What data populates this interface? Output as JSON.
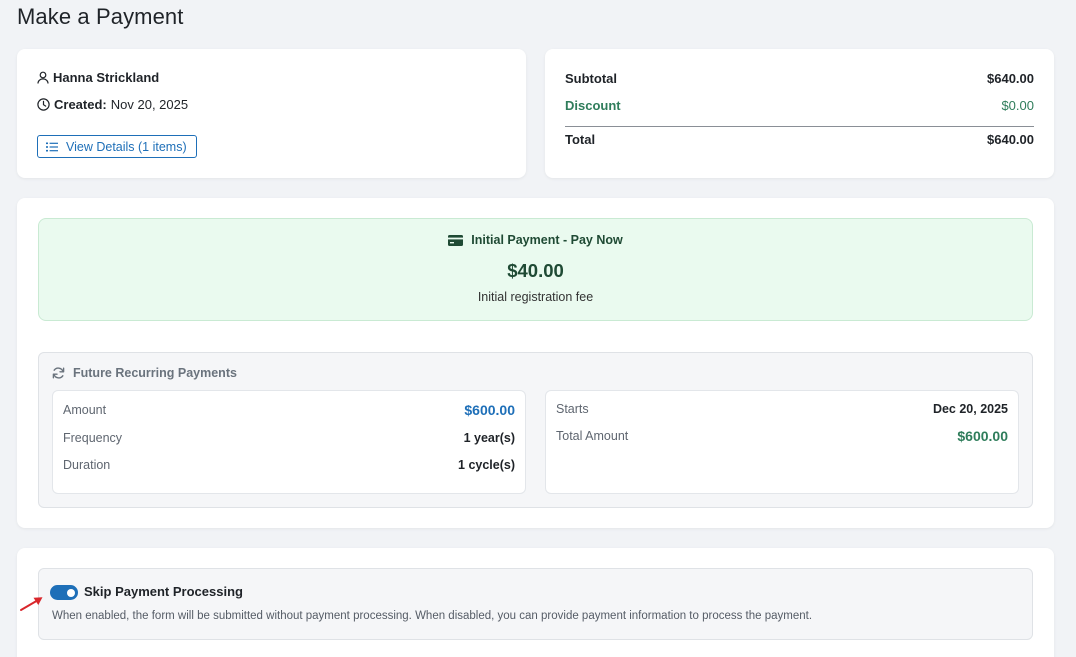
{
  "page": {
    "title": "Make a Payment"
  },
  "customer": {
    "name": "Hanna Strickland",
    "created_label": "Created:",
    "created_value": "Nov 20, 2025",
    "view_details_label": "View Details (1 items)"
  },
  "summary": {
    "subtotal_label": "Subtotal",
    "subtotal_value": "$640.00",
    "discount_label": "Discount",
    "discount_value": "$0.00",
    "total_label": "Total",
    "total_value": "$640.00"
  },
  "initial_payment": {
    "title": "Initial Payment - Pay Now",
    "amount": "$40.00",
    "description": "Initial registration fee"
  },
  "recurring": {
    "title": "Future Recurring Payments",
    "left": [
      {
        "label": "Amount",
        "value": "$600.00"
      },
      {
        "label": "Frequency",
        "value": "1 year(s)"
      },
      {
        "label": "Duration",
        "value": "1 cycle(s)"
      }
    ],
    "right": [
      {
        "label": "Starts",
        "value": "Dec 20, 2025"
      },
      {
        "label": "Total Amount",
        "value": "$600.00"
      }
    ]
  },
  "skip": {
    "label": "Skip Payment Processing",
    "enabled": true,
    "help": "When enabled, the form will be submitted without payment processing. When disabled, you can provide payment information to process the payment."
  },
  "colors": {
    "accent_blue": "#1e6fb8",
    "success_green": "#2f7d5b",
    "annotation_red": "#d9262b"
  },
  "icons": [
    "user-icon",
    "clock-icon",
    "list-icon",
    "credit-card-icon",
    "refresh-icon",
    "arrow-annotation-icon"
  ]
}
